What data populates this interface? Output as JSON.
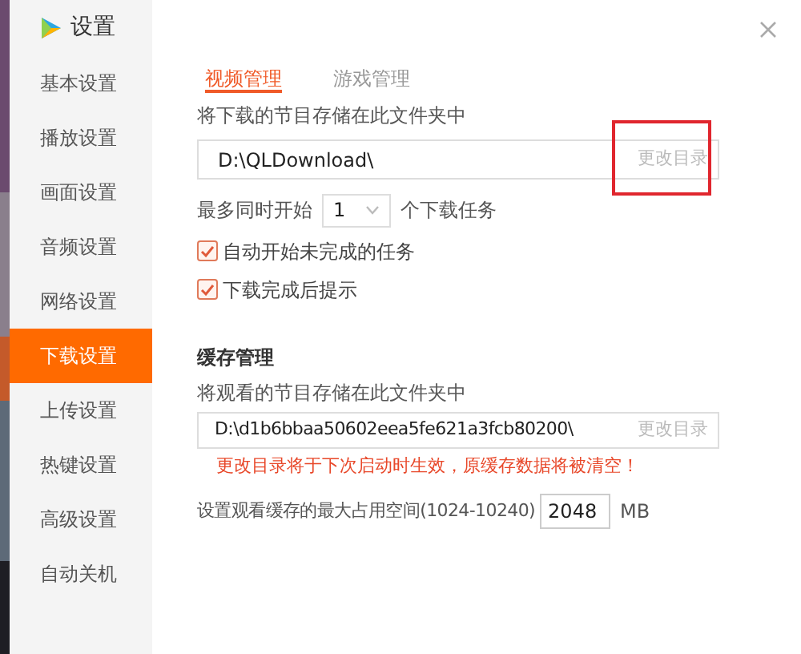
{
  "window": {
    "title": "设置"
  },
  "sidebar": {
    "items": [
      {
        "label": "基本设置",
        "selected": false
      },
      {
        "label": "播放设置",
        "selected": false
      },
      {
        "label": "画面设置",
        "selected": false
      },
      {
        "label": "音频设置",
        "selected": false
      },
      {
        "label": "网络设置",
        "selected": false
      },
      {
        "label": "下载设置",
        "selected": true
      },
      {
        "label": "上传设置",
        "selected": false
      },
      {
        "label": "热键设置",
        "selected": false
      },
      {
        "label": "高级设置",
        "selected": false
      },
      {
        "label": "自动关机",
        "selected": false
      }
    ]
  },
  "tabs": [
    {
      "label": "视频管理",
      "selected": true
    },
    {
      "label": "游戏管理",
      "selected": false
    }
  ],
  "download": {
    "folder_label": "将下载的节目存储在此文件夹中",
    "folder_path": "D:\\QLDownload\\",
    "change_button": "更改目录",
    "change_highlighted": true,
    "max_tasks_prefix": "最多同时开始",
    "max_tasks_value": "1",
    "max_tasks_suffix": "个下载任务",
    "options": [
      {
        "label": "自动开始未完成的任务",
        "checked": true
      },
      {
        "label": "下载完成后提示",
        "checked": true
      }
    ]
  },
  "cache": {
    "title": "缓存管理",
    "folder_label": "将观看的节目存储在此文件夹中",
    "folder_path": "D:\\d1b6bbaa50602eea5fe621a3fcb80200\\",
    "change_button": "更改目录",
    "warning": "更改目录将于下次启动时生效，原缓存数据将被清空！",
    "size_label": "设置观看缓存的最大占用空间(1024-10240)",
    "size_value": "2048",
    "size_unit": "MB"
  }
}
